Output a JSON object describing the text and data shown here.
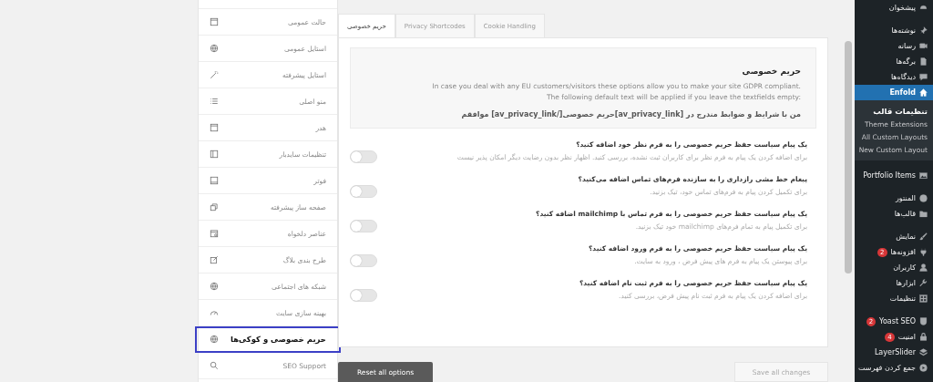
{
  "admin_menu": {
    "items": [
      {
        "label": "پیشخوان",
        "selected": false
      },
      {
        "label": "نوشته‌ها",
        "selected": false
      },
      {
        "label": "رسانه",
        "selected": false
      },
      {
        "label": "برگه‌ها",
        "selected": false
      },
      {
        "label": "دیدگاه‌ها",
        "selected": false
      },
      {
        "label": "Enfold",
        "selected": true,
        "children": [
          {
            "label": "تنظیمات قالب",
            "selected": true
          },
          {
            "label": "Theme Extensions",
            "selected": false
          },
          {
            "label": "All Custom Layouts",
            "selected": false
          },
          {
            "label": "New Custom Layout",
            "selected": false
          }
        ]
      },
      {
        "label": "Portfolio Items",
        "selected": false
      },
      {
        "label": "المنتور",
        "selected": false
      },
      {
        "label": "قالب‌ها",
        "selected": false
      },
      {
        "label": "نمایش",
        "selected": false
      },
      {
        "label": "افزونه‌ها",
        "selected": false,
        "badge": "2"
      },
      {
        "label": "کاربران",
        "selected": false
      },
      {
        "label": "ابزارها",
        "selected": false
      },
      {
        "label": "تنظیمات",
        "selected": false
      },
      {
        "label": "Yoast SEO",
        "selected": false,
        "badge": "2"
      },
      {
        "label": "امنیت",
        "selected": false,
        "badge": "4"
      },
      {
        "label": "LayerSlider",
        "selected": false
      },
      {
        "label": "جمع کردن فهرست",
        "selected": false
      }
    ]
  },
  "tabs": [
    {
      "label": "Cookie Handling",
      "selected": false
    },
    {
      "label": "Privacy Shortcodes",
      "selected": false
    },
    {
      "label": "حریم خصوصی",
      "selected": true
    }
  ],
  "intro": {
    "title": "حریم خصوصی",
    "lines": [
      "In case you deal with any EU customers/visitors these options allow you to make your site GDPR compliant.",
      "The following default text will be applied if you leave the textfields empty:"
    ],
    "default_text": "من با شرایط و ضوابط مندرج در [av_privacy_link]حریم خصوصی[/av_privacy_link] موافقم"
  },
  "options": [
    {
      "title": "یک پیام سیاست حفظ حریم خصوصی را به فرم نظر خود اضافه کنید؟",
      "description": "برای اضافه کردن یک پیام به فرم نظر برای کاربران ثبت نشده، بررسی کنید. اظهار نظر بدون رضایت دیگر امکان پذیر نیست",
      "on": false
    },
    {
      "title": "پیغام خط مشی رازداری را به سازنده فرم‌های تماس اضافه می‌کنید؟",
      "description": "برای تکمیل کردن پیام به فرم‌های تماس خود، تیک بزنید.",
      "on": false
    },
    {
      "title": "یک پیام سیاست حفظ حریم خصوصی را به فرم تماس با **mailchimp** اضافه کنید؟",
      "description": "برای تکمیل پیام به تمام فرم‌های mailchimp خود تیک بزنید.",
      "on": false
    },
    {
      "title": "یک پیام سیاست حفظ حریم خصوصی را به فرم ورود اضافه کنید؟",
      "description": "برای پیوستن یک پیام به فرم های پیش فرض ، ورود به سایت.",
      "on": false
    },
    {
      "title": "یک پیام سیاست حفظ حریم خصوصی را به فرم ثبت نام اضافه کنید؟",
      "description": "برای اضافه کردن یک پیام به فرم ثبت نام پیش فرض، بررسی کنید.",
      "on": false
    }
  ],
  "options_nav": [
    {
      "label": "حالت عمومی",
      "selected": false
    },
    {
      "label": "استایل عمومی",
      "selected": false
    },
    {
      "label": "استایل پیشرفته",
      "selected": false
    },
    {
      "label": "منو اصلی",
      "selected": false
    },
    {
      "label": "هدر",
      "selected": false
    },
    {
      "label": "تنظیمات سایدبار",
      "selected": false
    },
    {
      "label": "فوتر",
      "selected": false
    },
    {
      "label": "صفحه ساز پیشرفته",
      "selected": false
    },
    {
      "label": "عناصر دلخواه",
      "selected": false
    },
    {
      "label": "طرح بندی بلاگ",
      "selected": false
    },
    {
      "label": "شبکه های اجتماعی",
      "selected": false
    },
    {
      "label": "بهینه سازی سایت",
      "selected": false
    },
    {
      "label": "حریم خصوصی و کوکی‌ها",
      "selected": true
    },
    {
      "label": "SEO Support",
      "selected": false
    }
  ],
  "buttons": {
    "reset": "Reset all options",
    "save": "Save all changes"
  }
}
